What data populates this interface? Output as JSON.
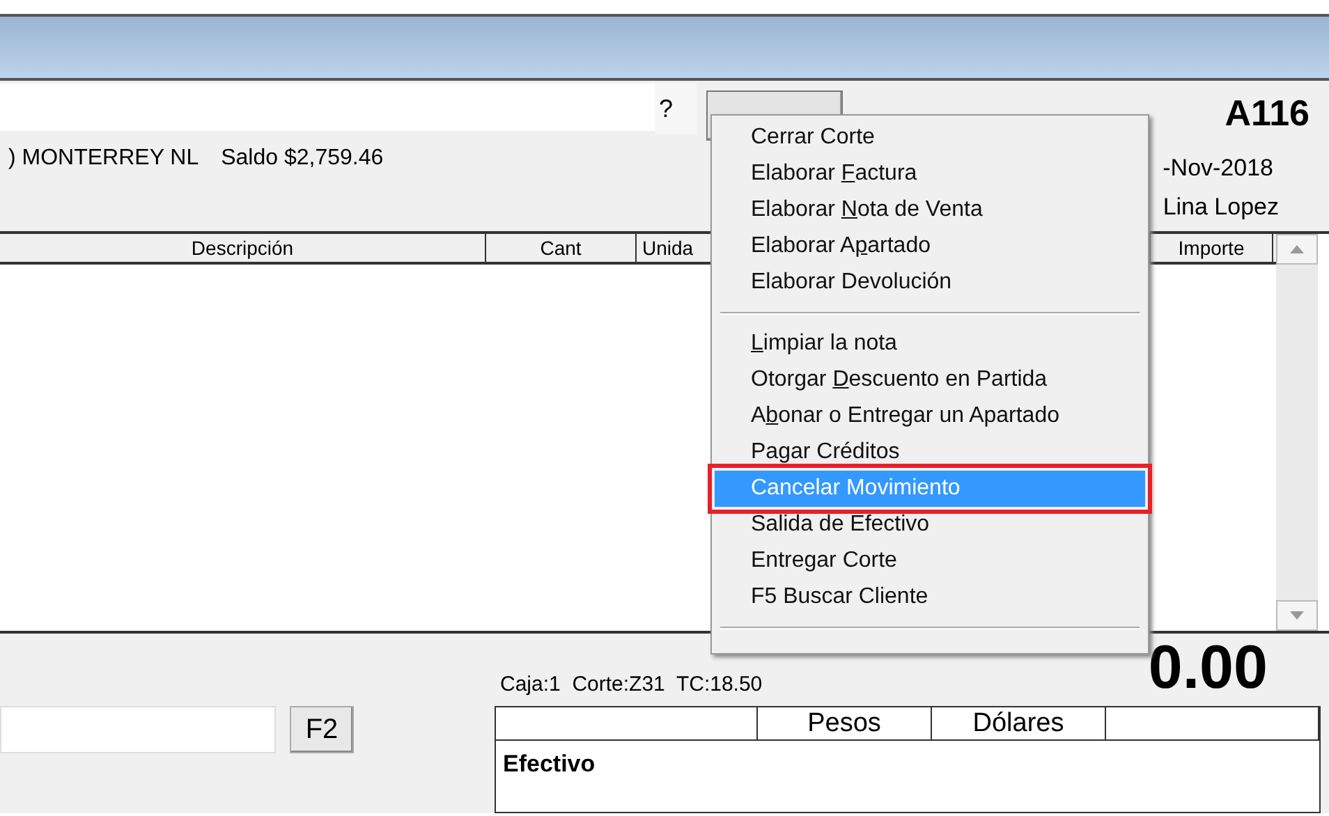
{
  "header": {
    "help": "?",
    "address": ") MONTERREY NL",
    "balance": "Saldo $2,759.46",
    "folio": "A116",
    "date": "-Nov-2018",
    "seller": "Lina Lopez"
  },
  "table": {
    "columns": [
      {
        "label": "Descripción"
      },
      {
        "label": "Cant"
      },
      {
        "label": "Unida"
      },
      {
        "label": "Importe"
      }
    ]
  },
  "menu": {
    "sections": [
      {
        "items": [
          {
            "label": "Cerrar Corte",
            "selected": false
          },
          {
            "before": "Elaborar ",
            "accel": "F",
            "after": "actura",
            "selected": false
          },
          {
            "before": "Elaborar ",
            "accel": "N",
            "after": "ota de Venta",
            "selected": false
          },
          {
            "before": "Elaborar A",
            "accel": "p",
            "after": "artado",
            "selected": false
          },
          {
            "label": "Elaborar Devolución",
            "selected": false
          }
        ]
      },
      {
        "items": [
          {
            "accel": "L",
            "after": "impiar la nota",
            "selected": false
          },
          {
            "before": "Otorgar ",
            "accel": "D",
            "after": "escuento en Partida",
            "selected": false
          },
          {
            "before": "A",
            "accel": "b",
            "after": "onar o Entregar un Apartado",
            "selected": false
          },
          {
            "label": "Pagar Créditos",
            "selected": false
          },
          {
            "label": "Cancelar Movimiento",
            "selected": true
          },
          {
            "label": "Salida de Efectivo",
            "selected": false
          },
          {
            "label": "Entregar Corte",
            "selected": false
          },
          {
            "label": "F5 Buscar Cliente",
            "selected": false
          }
        ]
      }
    ]
  },
  "footer": {
    "info": "Caja:1  Corte:Z31  TC:18.50",
    "total": "0.00",
    "f2_button": "F2",
    "payments": {
      "columns": [
        null,
        "Pesos",
        "Dólares",
        null
      ],
      "rows": [
        {
          "label": "Efectivo"
        }
      ]
    }
  }
}
